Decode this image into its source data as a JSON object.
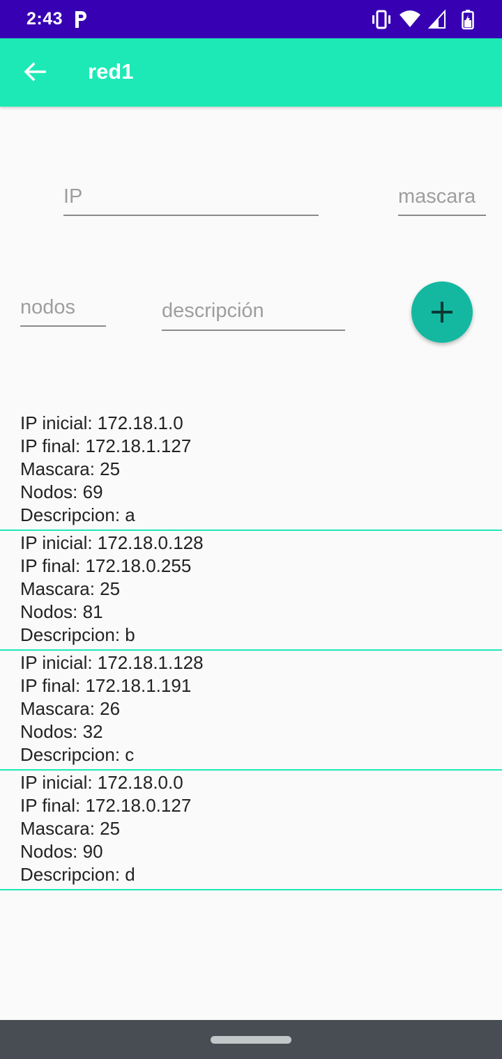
{
  "status_bar": {
    "time": "2:43",
    "icons": [
      "parking-icon",
      "vibrate-icon",
      "wifi-icon",
      "signal-icon",
      "battery-icon"
    ]
  },
  "app_bar": {
    "title": "red1",
    "back_icon": "arrow-left-icon"
  },
  "form": {
    "ip_placeholder": "IP",
    "ip_value": "",
    "mascara_placeholder": "mascara",
    "mascara_value": "",
    "nodos_placeholder": "nodos",
    "nodos_value": "",
    "descripcion_placeholder": "descripción",
    "descripcion_value": "",
    "add_icon": "plus-icon"
  },
  "subnets": [
    {
      "ip_inicial": "IP inicial: 172.18.1.0",
      "ip_final": "IP final: 172.18.1.127",
      "mascara": "Mascara: 25",
      "nodos": "Nodos: 69",
      "descripcion": "Descripcion: a"
    },
    {
      "ip_inicial": "IP inicial: 172.18.0.128",
      "ip_final": "IP final: 172.18.0.255",
      "mascara": "Mascara: 25",
      "nodos": "Nodos: 81",
      "descripcion": "Descripcion: b"
    },
    {
      "ip_inicial": "IP inicial: 172.18.1.128",
      "ip_final": "IP final: 172.18.1.191",
      "mascara": "Mascara: 26",
      "nodos": "Nodos: 32",
      "descripcion": "Descripcion: c"
    },
    {
      "ip_inicial": "IP inicial: 172.18.0.0",
      "ip_final": "IP final: 172.18.0.127",
      "mascara": "Mascara: 25",
      "nodos": "Nodos: 90",
      "descripcion": "Descripcion: d"
    }
  ],
  "colors": {
    "status_bar": "#3700b3",
    "app_bar": "#1de9b6",
    "fab": "#14b8a0",
    "divider": "#1de9b6",
    "nav_bar": "#474d52"
  }
}
